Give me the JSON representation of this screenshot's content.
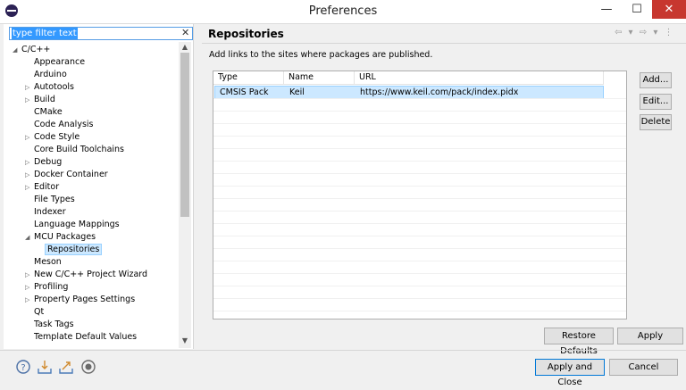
{
  "window": {
    "title": "Preferences",
    "minimize": "—",
    "maximize": "☐",
    "close": "✕"
  },
  "filter": {
    "value": "type filter text",
    "clear_icon": "✕"
  },
  "tree": {
    "root": "C/C++",
    "items": [
      {
        "label": "Appearance",
        "expand": ""
      },
      {
        "label": "Arduino",
        "expand": ""
      },
      {
        "label": "Autotools",
        "expand": "▷"
      },
      {
        "label": "Build",
        "expand": "▷"
      },
      {
        "label": "CMake",
        "expand": ""
      },
      {
        "label": "Code Analysis",
        "expand": ""
      },
      {
        "label": "Code Style",
        "expand": "▷"
      },
      {
        "label": "Core Build Toolchains",
        "expand": ""
      },
      {
        "label": "Debug",
        "expand": "▷"
      },
      {
        "label": "Docker Container",
        "expand": "▷"
      },
      {
        "label": "Editor",
        "expand": "▷"
      },
      {
        "label": "File Types",
        "expand": ""
      },
      {
        "label": "Indexer",
        "expand": ""
      },
      {
        "label": "Language Mappings",
        "expand": ""
      },
      {
        "label": "MCU Packages",
        "expand": "◢"
      },
      {
        "label": "Repositories",
        "expand": "",
        "child": true,
        "selected": true
      },
      {
        "label": "Meson",
        "expand": ""
      },
      {
        "label": "New C/C++ Project Wizard",
        "expand": "▷"
      },
      {
        "label": "Profiling",
        "expand": "▷"
      },
      {
        "label": "Property Pages Settings",
        "expand": "▷"
      },
      {
        "label": "Qt",
        "expand": ""
      },
      {
        "label": "Task Tags",
        "expand": ""
      },
      {
        "label": "Template Default Values",
        "expand": ""
      }
    ]
  },
  "page": {
    "title": "Repositories",
    "description": "Add links to the sites where packages are published.",
    "nav_icons": "⇦ ▾ ⇨ ▾ ⋮"
  },
  "table": {
    "columns": [
      "Type",
      "Name",
      "URL"
    ],
    "rows": [
      {
        "type": "CMSIS Pack",
        "name": "Keil",
        "url": "https://www.keil.com/pack/index.pidx"
      }
    ]
  },
  "buttons": {
    "add": "Add...",
    "edit": "Edit...",
    "delete": "Delete",
    "restore": "Restore Defaults",
    "apply": "Apply",
    "apply_close": "Apply and Close",
    "cancel": "Cancel"
  },
  "bottom_icons": [
    "help-icon",
    "import-icon",
    "export-icon",
    "record-icon"
  ],
  "colors": {
    "selection": "#cce8ff",
    "accent": "#0078d7",
    "close": "#c7372f"
  }
}
